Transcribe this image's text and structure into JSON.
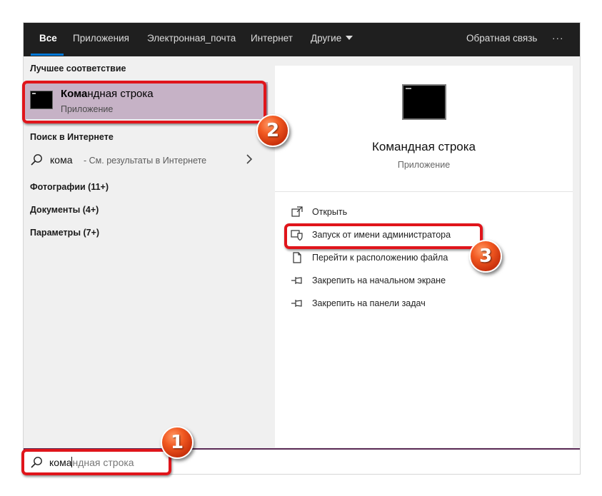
{
  "tabs": {
    "all": "Все",
    "apps": "Приложения",
    "email": "Электронная_почта",
    "web": "Интернет",
    "more": "Другие",
    "feedback": "Обратная связь",
    "overflow": "···"
  },
  "left": {
    "best_match_title": "Лучшее соответствие",
    "best_match": {
      "name_bold": "Кома",
      "name_rest": "ндная строка",
      "subtitle": "Приложение",
      "icon": "cmd-icon"
    },
    "web_search_title": "Поиск в Интернете",
    "web_search": {
      "query": "кома",
      "hint": "- См. результаты в Интернете"
    },
    "groups": [
      "Фотографии (11+)",
      "Документы (4+)",
      "Параметры (7+)"
    ]
  },
  "right": {
    "title": "Командная строка",
    "subtitle": "Приложение",
    "actions": [
      {
        "label": "Открыть",
        "icon": "open-icon"
      },
      {
        "label": "Запуск от имени администратора",
        "icon": "run-as-admin-icon"
      },
      {
        "label": "Перейти к расположению файла",
        "icon": "file-location-icon"
      },
      {
        "label": "Закрепить на начальном экране",
        "icon": "pin-icon"
      },
      {
        "label": "Закрепить на панели задач",
        "icon": "pin-icon"
      }
    ]
  },
  "search": {
    "typed": "кома",
    "suggestion": "ндная строка"
  },
  "annotations": {
    "step1": "1",
    "step2": "2",
    "step3": "3",
    "color": "#e0151b"
  },
  "colors": {
    "accent": "#0078d7",
    "selected_item": "#c6b2c6",
    "topbar": "#1f1f1f"
  }
}
